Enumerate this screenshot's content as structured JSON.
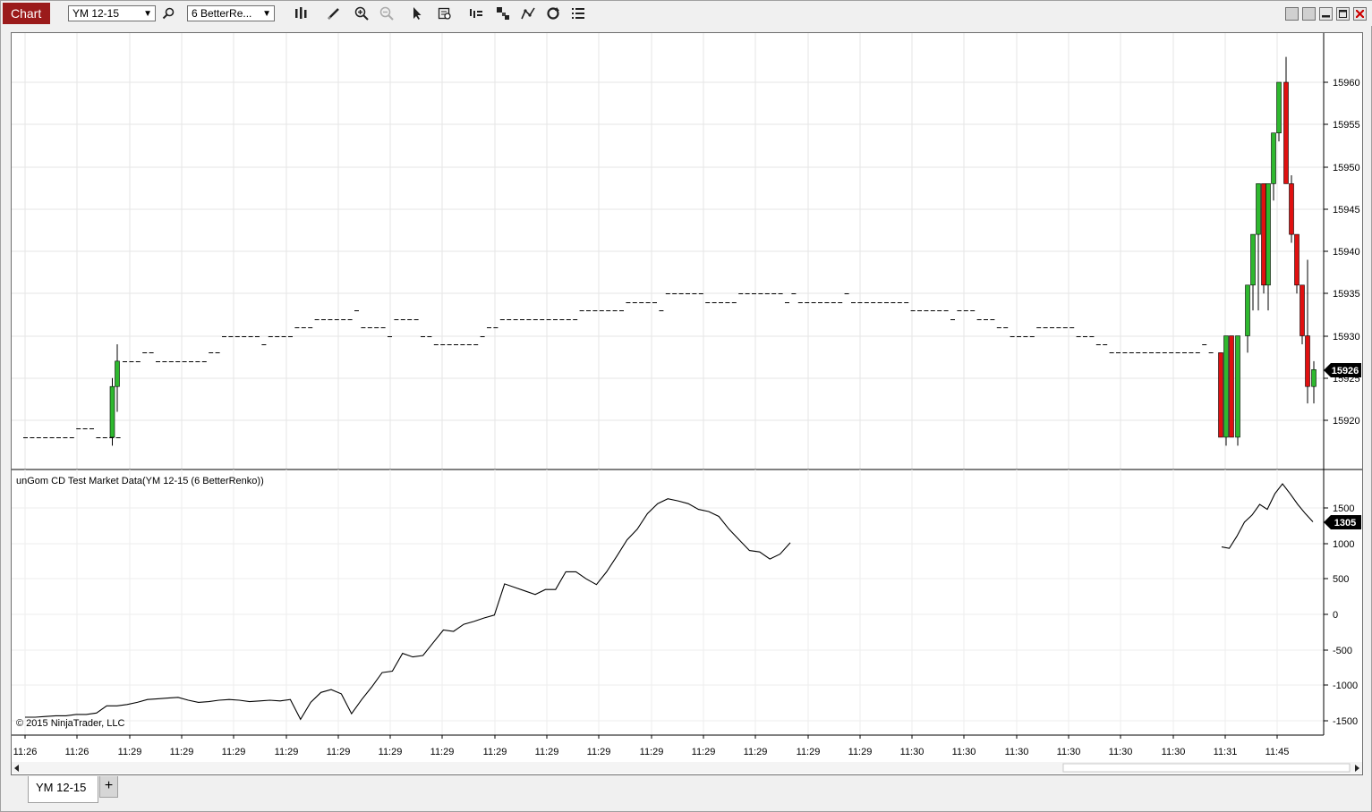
{
  "toolbar": {
    "chart_label": "Chart",
    "instrument": "YM 12-15",
    "period": "6 BetterRe...",
    "icons": [
      "search-icon",
      "bar-style-icon",
      "pencil-draw-icon",
      "zoom-in-icon",
      "zoom-out-icon",
      "pointer-icon",
      "data-box-icon",
      "indicators-icon",
      "strategies-icon",
      "drawing-objects-icon",
      "reload-icon",
      "properties-list-icon"
    ]
  },
  "window_controls": [
    "minimize-icon",
    "maximize-icon",
    "restore-icon",
    "close-icon"
  ],
  "price_panel": {
    "y_ticks": [
      "15960",
      "15955",
      "15950",
      "15945",
      "15940",
      "15935",
      "15930",
      "15925",
      "15920"
    ],
    "last_price": "15926",
    "colors": {
      "up": "#2eb82e",
      "down": "#e01010",
      "last_badge": "#000000"
    }
  },
  "indicator_panel": {
    "title": "unGom CD Test Market Data(YM 12-15 (6 BetterRenko))",
    "y_ticks": [
      "1500",
      "1000",
      "500",
      "0",
      "-500",
      "-1000",
      "-1500"
    ],
    "last_value": "1305",
    "copyright": "© 2015 NinjaTrader, LLC"
  },
  "x_axis": {
    "labels": [
      "11:26",
      "11:26",
      "11:29",
      "11:29",
      "11:29",
      "11:29",
      "11:29",
      "11:29",
      "11:29",
      "11:29",
      "11:29",
      "11:29",
      "11:29",
      "11:29",
      "11:29",
      "11:29",
      "11:29",
      "11:30",
      "11:30",
      "11:30",
      "11:30",
      "11:30",
      "11:30",
      "11:31",
      "11:45"
    ]
  },
  "tabs": [
    {
      "label": "YM 12-15"
    }
  ],
  "add_tab_label": "+",
  "chart_data": [
    {
      "type": "candlestick",
      "title": "",
      "ylim": [
        15915,
        15965
      ],
      "candles": [
        {
          "o": 15926,
          "c": 15926,
          "h": 15926,
          "l": 15926
        },
        {
          "o": 15918,
          "c": 15924,
          "h": 15925,
          "l": 15917
        },
        {
          "o": 15924,
          "c": 15927,
          "h": 15929,
          "l": 15921
        },
        {
          "o": 15928,
          "c": 15918,
          "h": 15928,
          "l": 15918
        },
        {
          "o": 15918,
          "c": 15930,
          "h": 15930,
          "l": 15917
        },
        {
          "o": 15930,
          "c": 15918,
          "h": 15930,
          "l": 15918
        },
        {
          "o": 15918,
          "c": 15930,
          "h": 15930,
          "l": 15917
        },
        {
          "o": 15930,
          "c": 15936,
          "h": 15936,
          "l": 15928
        },
        {
          "o": 15936,
          "c": 15942,
          "h": 15942,
          "l": 15933
        },
        {
          "o": 15942,
          "c": 15948,
          "h": 15948,
          "l": 15933
        },
        {
          "o": 15948,
          "c": 15936,
          "h": 15948,
          "l": 15935
        },
        {
          "o": 15936,
          "c": 15948,
          "h": 15948,
          "l": 15933
        },
        {
          "o": 15948,
          "c": 15954,
          "h": 15954,
          "l": 15946
        },
        {
          "o": 15954,
          "c": 15960,
          "h": 15960,
          "l": 15953
        },
        {
          "o": 15960,
          "c": 15948,
          "h": 15963,
          "l": 15948
        },
        {
          "o": 15948,
          "c": 15942,
          "h": 15949,
          "l": 15941
        },
        {
          "o": 15942,
          "c": 15936,
          "h": 15942,
          "l": 15935
        },
        {
          "o": 15936,
          "c": 15930,
          "h": 15936,
          "l": 15929
        },
        {
          "o": 15930,
          "c": 15924,
          "h": 15939,
          "l": 15922
        },
        {
          "o": 15924,
          "c": 15926,
          "h": 15927,
          "l": 15922
        }
      ]
    },
    {
      "type": "line",
      "title": "unGom CD Test Market Data(YM 12-15 (6 BetterRenko))",
      "ylim": [
        -1500,
        1500
      ],
      "series": [
        {
          "name": "",
          "values": [
            -1450,
            -1450,
            -1440,
            -1430,
            -1430,
            -1410,
            -1410,
            -1390,
            -1290,
            -1290,
            -1270,
            -1240,
            -1200,
            -1190,
            -1180,
            -1170,
            -1210,
            -1240,
            -1230,
            -1210,
            -1200,
            -1210,
            -1230,
            -1220,
            -1210,
            -1220,
            -1200,
            -1480,
            -1240,
            -1100,
            -1060,
            -1120,
            -1400,
            -1200,
            -1020,
            -820,
            -800,
            -550,
            -600,
            -580,
            -400,
            -220,
            -240,
            -140,
            -100,
            -50,
            -10,
            430,
            380,
            330,
            280,
            350,
            350,
            600,
            600,
            500,
            420,
            600,
            820,
            1050,
            1200,
            1420,
            1560,
            1630,
            1600,
            1560,
            1480,
            1450,
            1380,
            1200,
            1050,
            900,
            880,
            780,
            850,
            1010
          ]
        },
        {
          "name": "",
          "values": [
            950,
            930,
            1100,
            1300,
            1400,
            1550,
            1480,
            1700,
            1840,
            1700,
            1550,
            1420,
            1305
          ]
        }
      ]
    }
  ]
}
